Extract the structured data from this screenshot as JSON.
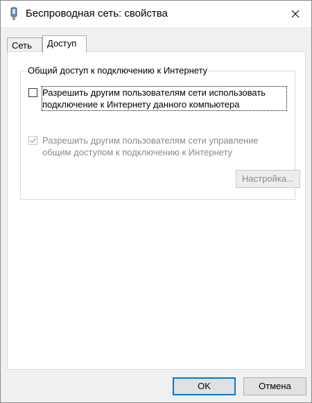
{
  "window": {
    "title": "Беспроводная сеть: свойства",
    "icon": "wireless-adapter-icon"
  },
  "tabs": [
    {
      "label": "Сеть",
      "active": false
    },
    {
      "label": "Доступ",
      "active": true
    }
  ],
  "group": {
    "legend": "Общий доступ к подключению к Интернету",
    "allow_sharing": {
      "label": "Разрешить другим пользователям сети использовать подключение к Интернету данного компьютера",
      "checked": false
    },
    "allow_control": {
      "label": "Разрешить другим пользователям сети управление общим доступом к подключению к Интернету",
      "checked": true,
      "disabled": true
    },
    "settings_button": "Настройка..."
  },
  "buttons": {
    "ok": "OK",
    "cancel": "Отмена"
  }
}
